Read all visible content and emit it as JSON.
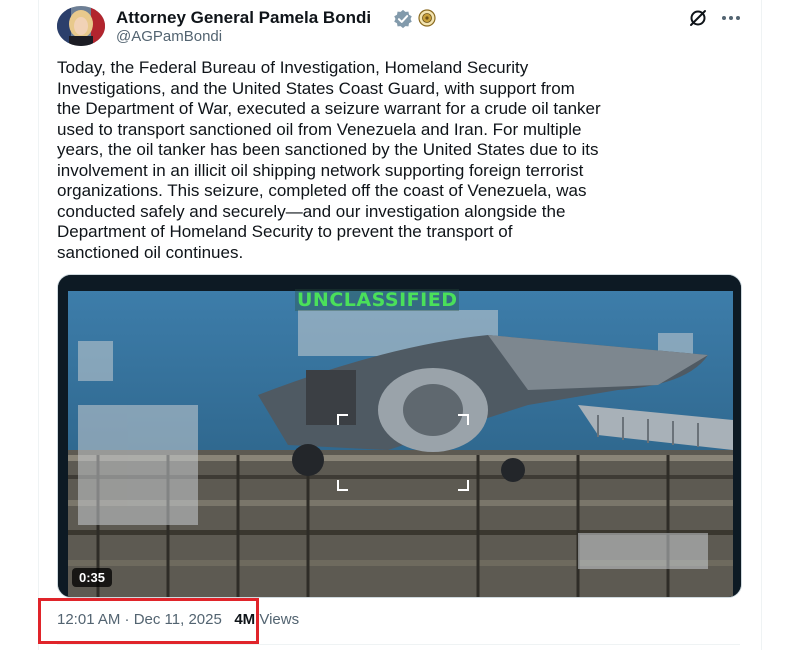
{
  "author": {
    "name": "Attorney General Pamela Bondi",
    "handle": "@AGPamBondi",
    "verified_color": "#829aab",
    "seal_color": "#c8a03a"
  },
  "icons": {
    "avatar": "avatar",
    "verified": "verified-badge-icon",
    "affiliation": "government-seal-icon",
    "grok": "grok-icon",
    "more": "more-options-icon"
  },
  "tweet": {
    "text": "Today, the Federal Bureau of Investigation, Homeland Security\nInvestigations, and the United States Coast Guard, with support from\nthe Department of War, executed a seizure warrant for a crude oil tanker\nused to transport sanctioned oil from Venezuela and Iran. For multiple\nyears, the oil tanker has been sanctioned by the United States due to its\ninvolvement in an illicit oil shipping network supporting foreign terrorist\norganizations. This seizure, completed off the coast of Venezuela, was\nconducted safely and securely—and our investigation alongside the\nDepartment of Homeland Security to prevent the transport of\nsanctioned oil continues."
  },
  "media": {
    "overlay_label": "UNCLASSIFIED",
    "duration": "0:35"
  },
  "meta": {
    "timestamp": "12:01 AM · Dec 11, 2025",
    "views_count": "4M",
    "views_label": "Views",
    "highlight_color": "#e0242a"
  }
}
